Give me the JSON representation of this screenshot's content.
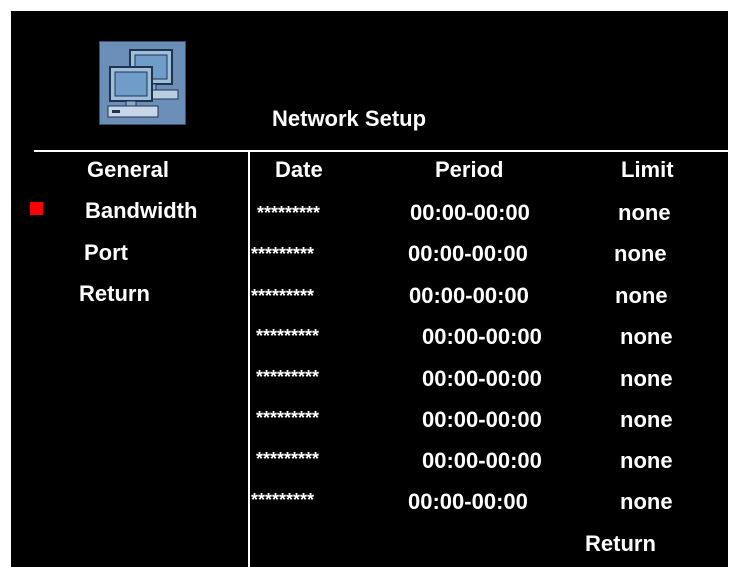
{
  "header": {
    "title": "Network Setup",
    "icon": "network-computers-icon"
  },
  "menu": {
    "items": [
      {
        "label": "General",
        "selected": false
      },
      {
        "label": "Bandwidth",
        "selected": true
      },
      {
        "label": "Port",
        "selected": false
      },
      {
        "label": "Return",
        "selected": false
      }
    ]
  },
  "table": {
    "columns": [
      "Date",
      "Period",
      "Limit"
    ],
    "rows": [
      {
        "date": "*********",
        "period": "00:00-00:00",
        "limit": "none"
      },
      {
        "date": "*********",
        "period": "00:00-00:00",
        "limit": "none"
      },
      {
        "date": "*********",
        "period": "00:00-00:00",
        "limit": "none"
      },
      {
        "date": "*********",
        "period": "00:00-00:00",
        "limit": "none"
      },
      {
        "date": "*********",
        "period": "00:00-00:00",
        "limit": "none"
      },
      {
        "date": "*********",
        "period": "00:00-00:00",
        "limit": "none"
      },
      {
        "date": "*********",
        "period": "00:00-00:00",
        "limit": "none"
      },
      {
        "date": "*********",
        "period": "00:00-00:00",
        "limit": "none"
      }
    ],
    "return_label": "Return"
  },
  "colors": {
    "background": "#000000",
    "text": "#ffffff",
    "selection_marker": "#ff0000",
    "icon_bg": "#6b8fb8"
  }
}
